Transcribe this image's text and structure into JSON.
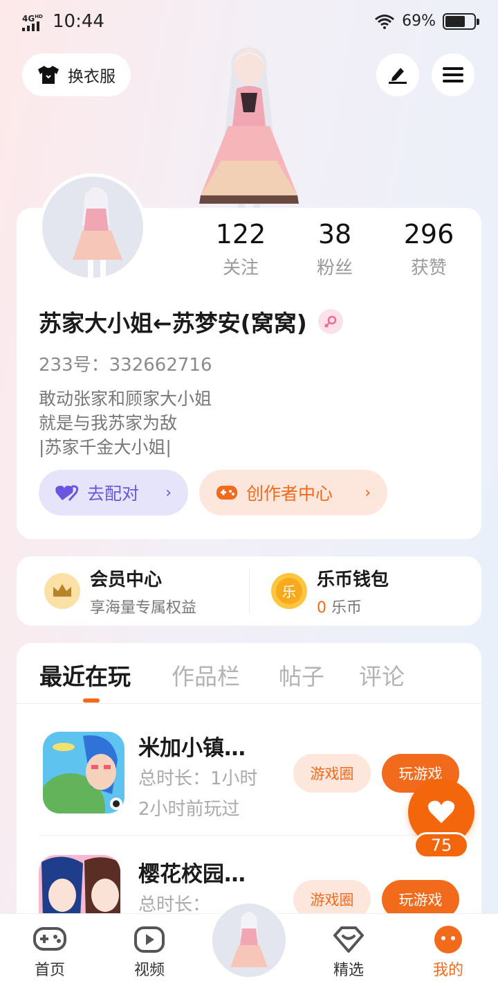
{
  "status_bar": {
    "network": "4G",
    "network_sup": "HD",
    "time": "10:44",
    "battery": "69%",
    "battery_level": 0.69
  },
  "top": {
    "dress_label": "换衣服"
  },
  "profile": {
    "stats": [
      {
        "value": "122",
        "label": "关注"
      },
      {
        "value": "38",
        "label": "粉丝"
      },
      {
        "value": "296",
        "label": "获赞"
      }
    ],
    "nickname": "苏家大小姐←苏梦安(窝窝)",
    "uid": "233号：332662716",
    "bio": [
      "敢动张家和顾家大小姐",
      "就是与我苏家为敌",
      "|苏家千金大小姐|"
    ],
    "pair_label": "去配对",
    "creator_label": "创作者中心"
  },
  "wallet": {
    "member_title": "会员中心",
    "member_sub": "享海量专属权益",
    "coin_title": "乐币钱包",
    "coin_icon_text": "乐",
    "coin_value": "0",
    "coin_unit": "乐币"
  },
  "tabs": [
    "最近在玩",
    "作品栏",
    "帖子",
    "评论"
  ],
  "games": [
    {
      "name": "米加小镇…",
      "duration": "总时长：1小时",
      "last": "2小时前玩过",
      "circle_label": "游戏圈",
      "play_label": "玩游戏"
    },
    {
      "name": "樱花校园…",
      "duration": "总时长：",
      "circle_label": "游戏圈",
      "play_label": "玩游戏"
    }
  ],
  "like": {
    "count": "75"
  },
  "nav": [
    {
      "label": "首页",
      "icon": "gamepad-icon"
    },
    {
      "label": "视频",
      "icon": "video-play-icon"
    },
    {
      "label": "精选",
      "icon": "heart-diamond-icon"
    },
    {
      "label": "我的",
      "icon": "profile-face-icon"
    }
  ],
  "colors": {
    "accent": "#f26a1b",
    "pair": "#6b55e0"
  }
}
